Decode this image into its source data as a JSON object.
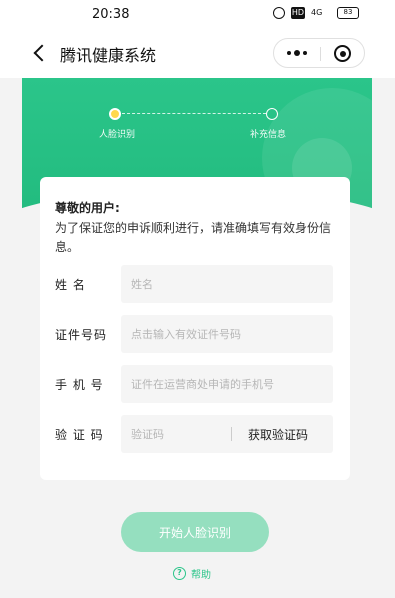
{
  "status_bar": {
    "time": "20:38",
    "icons": [
      "alarm-icon",
      "hd-icon",
      "signal-icon",
      "battery-icon"
    ],
    "hd_label": "HD",
    "signal_label": "4G",
    "battery_label": "83"
  },
  "nav": {
    "title": "腾讯健康系统",
    "back_icon": "chevron-left-icon",
    "more_icon": "more-icon",
    "close_icon": "record-icon"
  },
  "steps": [
    {
      "label": "人脸识别",
      "active": true
    },
    {
      "label": "补充信息",
      "active": false
    }
  ],
  "form": {
    "greeting": "尊敬的用户:",
    "notice": "为了保证您的申诉顺利进行，请准确填写有效身份信息。",
    "fields": [
      {
        "label": "姓  名",
        "placeholder": "姓名"
      },
      {
        "label": "证件号码",
        "placeholder": "点击输入有效证件号码"
      },
      {
        "label": "手 机 号",
        "placeholder": "证件在运营商处申请的手机号"
      },
      {
        "label": "验 证 码",
        "placeholder": "验证码"
      }
    ],
    "get_code_label": "获取验证码"
  },
  "actions": {
    "start_label": "开始人脸识别",
    "help_label": "帮助",
    "help_icon": "question-circle-icon"
  },
  "colors": {
    "primary": "#2bc58a",
    "button_disabled": "#95dfbf",
    "step_active": "#ffd84d"
  }
}
